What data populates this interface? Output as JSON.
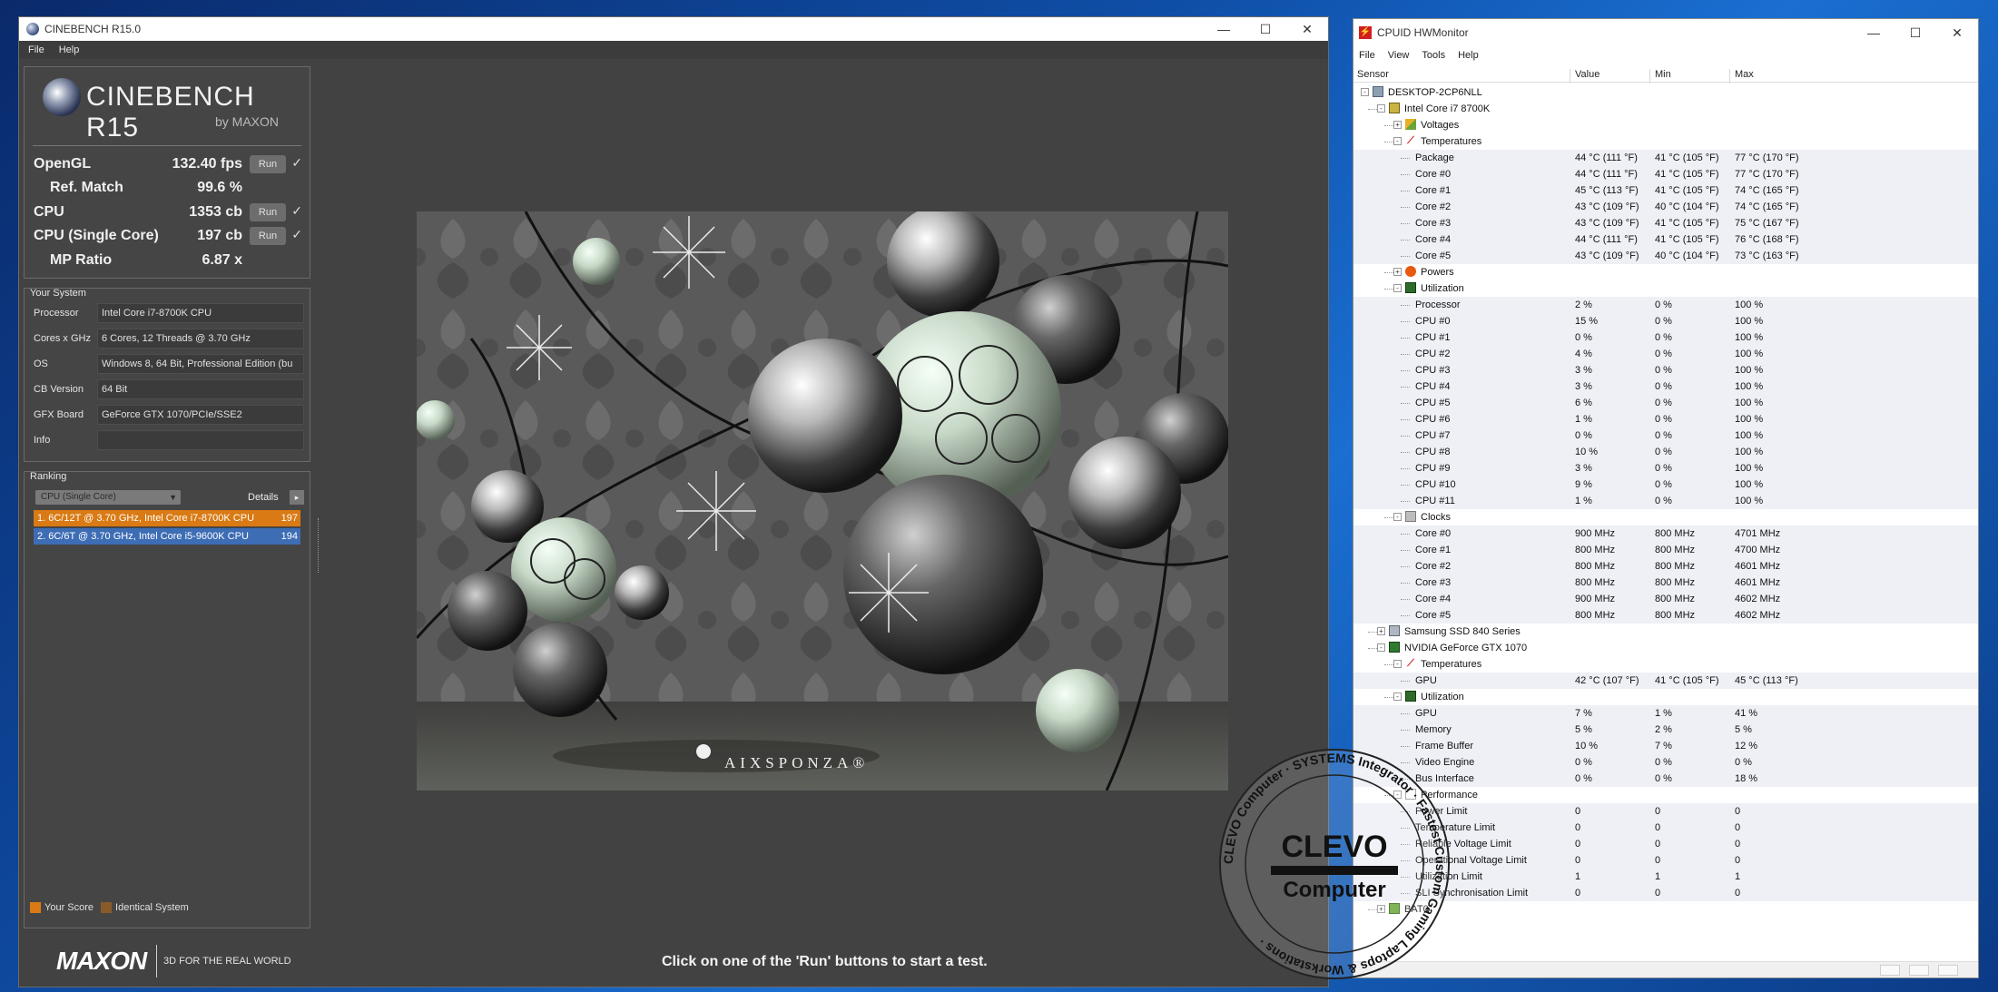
{
  "cinebench": {
    "window_title": "CINEBENCH R15.0",
    "menu": [
      "File",
      "Help"
    ],
    "logo_brand": "CINEBENCH R15",
    "logo_sub": "by MAXON",
    "scores": {
      "opengl_label": "OpenGL",
      "opengl_value": "132.40 fps",
      "refmatch_label": "Ref. Match",
      "refmatch_value": "99.6 %",
      "cpu_label": "CPU",
      "cpu_value": "1353 cb",
      "single_label": "CPU (Single Core)",
      "single_value": "197 cb",
      "mp_label": "MP Ratio",
      "mp_value": "6.87 x",
      "run_label": "Run",
      "check": "✓"
    },
    "system": {
      "title": "Your System",
      "rows": [
        {
          "label": "Processor",
          "value": "Intel Core i7-8700K CPU"
        },
        {
          "label": "Cores x GHz",
          "value": "6 Cores, 12 Threads @ 3.70 GHz"
        },
        {
          "label": "OS",
          "value": "Windows 8, 64 Bit, Professional Edition (bu"
        },
        {
          "label": "CB Version",
          "value": "64 Bit"
        },
        {
          "label": "GFX Board",
          "value": "GeForce GTX 1070/PCIe/SSE2"
        },
        {
          "label": "Info",
          "value": ""
        }
      ]
    },
    "ranking": {
      "title": "Ranking",
      "selected": "CPU (Single Core)",
      "details_label": "Details",
      "details_btn": "▸",
      "items": [
        {
          "text": "1. 6C/12T @ 3.70 GHz, Intel Core i7-8700K CPU",
          "score": "197"
        },
        {
          "text": "2. 6C/6T @ 3.70 GHz, Intel Core i5-9600K CPU",
          "score": "194"
        }
      ],
      "legend_your": "Your Score",
      "legend_identical": "Identical System"
    },
    "footer": {
      "maxon": "MAXON",
      "tagline": "3D FOR THE REAL WORLD"
    },
    "render_watermark": "AIXSPONZA®",
    "status": "Click on one of the 'Run' buttons to start a test."
  },
  "hwmonitor": {
    "window_title": "CPUID HWMonitor",
    "menu": [
      "File",
      "View",
      "Tools",
      "Help"
    ],
    "columns": [
      "Sensor",
      "Value",
      "Min",
      "Max"
    ],
    "rows": [
      {
        "name": "DESKTOP-2CP6NLL",
        "v1": "",
        "v2": "",
        "v3": ""
      },
      {
        "name": "Intel Core i7 8700K",
        "v1": "",
        "v2": "",
        "v3": ""
      },
      {
        "name": "Voltages",
        "v1": "",
        "v2": "",
        "v3": ""
      },
      {
        "name": "Temperatures",
        "v1": "",
        "v2": "",
        "v3": ""
      },
      {
        "name": "Package",
        "v1": "44 °C  (111 °F)",
        "v2": "41 °C  (105 °F)",
        "v3": "77 °C  (170 °F)"
      },
      {
        "name": "Core #0",
        "v1": "44 °C  (111 °F)",
        "v2": "41 °C  (105 °F)",
        "v3": "77 °C  (170 °F)"
      },
      {
        "name": "Core #1",
        "v1": "45 °C  (113 °F)",
        "v2": "41 °C  (105 °F)",
        "v3": "74 °C  (165 °F)"
      },
      {
        "name": "Core #2",
        "v1": "43 °C  (109 °F)",
        "v2": "40 °C  (104 °F)",
        "v3": "74 °C  (165 °F)"
      },
      {
        "name": "Core #3",
        "v1": "43 °C  (109 °F)",
        "v2": "41 °C  (105 °F)",
        "v3": "75 °C  (167 °F)"
      },
      {
        "name": "Core #4",
        "v1": "44 °C  (111 °F)",
        "v2": "41 °C  (105 °F)",
        "v3": "76 °C  (168 °F)"
      },
      {
        "name": "Core #5",
        "v1": "43 °C  (109 °F)",
        "v2": "40 °C  (104 °F)",
        "v3": "73 °C  (163 °F)"
      },
      {
        "name": "Powers",
        "v1": "",
        "v2": "",
        "v3": ""
      },
      {
        "name": "Utilization",
        "v1": "",
        "v2": "",
        "v3": ""
      },
      {
        "name": "Processor",
        "v1": "2 %",
        "v2": "0 %",
        "v3": "100 %"
      },
      {
        "name": "CPU #0",
        "v1": "15 %",
        "v2": "0 %",
        "v3": "100 %"
      },
      {
        "name": "CPU #1",
        "v1": "0 %",
        "v2": "0 %",
        "v3": "100 %"
      },
      {
        "name": "CPU #2",
        "v1": "4 %",
        "v2": "0 %",
        "v3": "100 %"
      },
      {
        "name": "CPU #3",
        "v1": "3 %",
        "v2": "0 %",
        "v3": "100 %"
      },
      {
        "name": "CPU #4",
        "v1": "3 %",
        "v2": "0 %",
        "v3": "100 %"
      },
      {
        "name": "CPU #5",
        "v1": "6 %",
        "v2": "0 %",
        "v3": "100 %"
      },
      {
        "name": "CPU #6",
        "v1": "1 %",
        "v2": "0 %",
        "v3": "100 %"
      },
      {
        "name": "CPU #7",
        "v1": "0 %",
        "v2": "0 %",
        "v3": "100 %"
      },
      {
        "name": "CPU #8",
        "v1": "10 %",
        "v2": "0 %",
        "v3": "100 %"
      },
      {
        "name": "CPU #9",
        "v1": "3 %",
        "v2": "0 %",
        "v3": "100 %"
      },
      {
        "name": "CPU #10",
        "v1": "9 %",
        "v2": "0 %",
        "v3": "100 %"
      },
      {
        "name": "CPU #11",
        "v1": "1 %",
        "v2": "0 %",
        "v3": "100 %"
      },
      {
        "name": "Clocks",
        "v1": "",
        "v2": "",
        "v3": ""
      },
      {
        "name": "Core #0",
        "v1": "900 MHz",
        "v2": "800 MHz",
        "v3": "4701 MHz"
      },
      {
        "name": "Core #1",
        "v1": "800 MHz",
        "v2": "800 MHz",
        "v3": "4700 MHz"
      },
      {
        "name": "Core #2",
        "v1": "800 MHz",
        "v2": "800 MHz",
        "v3": "4601 MHz"
      },
      {
        "name": "Core #3",
        "v1": "800 MHz",
        "v2": "800 MHz",
        "v3": "4601 MHz"
      },
      {
        "name": "Core #4",
        "v1": "900 MHz",
        "v2": "800 MHz",
        "v3": "4602 MHz"
      },
      {
        "name": "Core #5",
        "v1": "800 MHz",
        "v2": "800 MHz",
        "v3": "4602 MHz"
      },
      {
        "name": "Samsung SSD 840 Series",
        "v1": "",
        "v2": "",
        "v3": ""
      },
      {
        "name": "NVIDIA GeForce GTX 1070",
        "v1": "",
        "v2": "",
        "v3": ""
      },
      {
        "name": "Temperatures",
        "v1": "",
        "v2": "",
        "v3": ""
      },
      {
        "name": "GPU",
        "v1": "42 °C  (107 °F)",
        "v2": "41 °C  (105 °F)",
        "v3": "45 °C  (113 °F)"
      },
      {
        "name": "Utilization",
        "v1": "",
        "v2": "",
        "v3": ""
      },
      {
        "name": "GPU",
        "v1": "7 %",
        "v2": "1 %",
        "v3": "41 %"
      },
      {
        "name": "Memory",
        "v1": "5 %",
        "v2": "2 %",
        "v3": "5 %"
      },
      {
        "name": "Frame Buffer",
        "v1": "10 %",
        "v2": "7 %",
        "v3": "12 %"
      },
      {
        "name": "Video Engine",
        "v1": "0 %",
        "v2": "0 %",
        "v3": "0 %"
      },
      {
        "name": "Bus Interface",
        "v1": "0 %",
        "v2": "0 %",
        "v3": "18 %"
      },
      {
        "name": "Performance",
        "v1": "",
        "v2": "",
        "v3": ""
      },
      {
        "name": "Power Limit",
        "v1": "0",
        "v2": "0",
        "v3": "0"
      },
      {
        "name": "Temperature Limit",
        "v1": "0",
        "v2": "0",
        "v3": "0"
      },
      {
        "name": "Reliable Voltage Limit",
        "v1": "0",
        "v2": "0",
        "v3": "0"
      },
      {
        "name": "Operational Voltage Limit",
        "v1": "0",
        "v2": "0",
        "v3": "0"
      },
      {
        "name": "Utilization Limit",
        "v1": "1",
        "v2": "1",
        "v3": "1"
      },
      {
        "name": "SLI Synchronisation Limit",
        "v1": "0",
        "v2": "0",
        "v3": "0"
      },
      {
        "name": "BAT0",
        "v1": "",
        "v2": "",
        "v3": ""
      }
    ]
  },
  "stamp": {
    "logo": "CLEVO",
    "sub": "Computer",
    "ring_text": "CLEVO Computer · SYSTEMS Integrator · Fastest Custom Gaming Laptops & Workstations ·"
  }
}
